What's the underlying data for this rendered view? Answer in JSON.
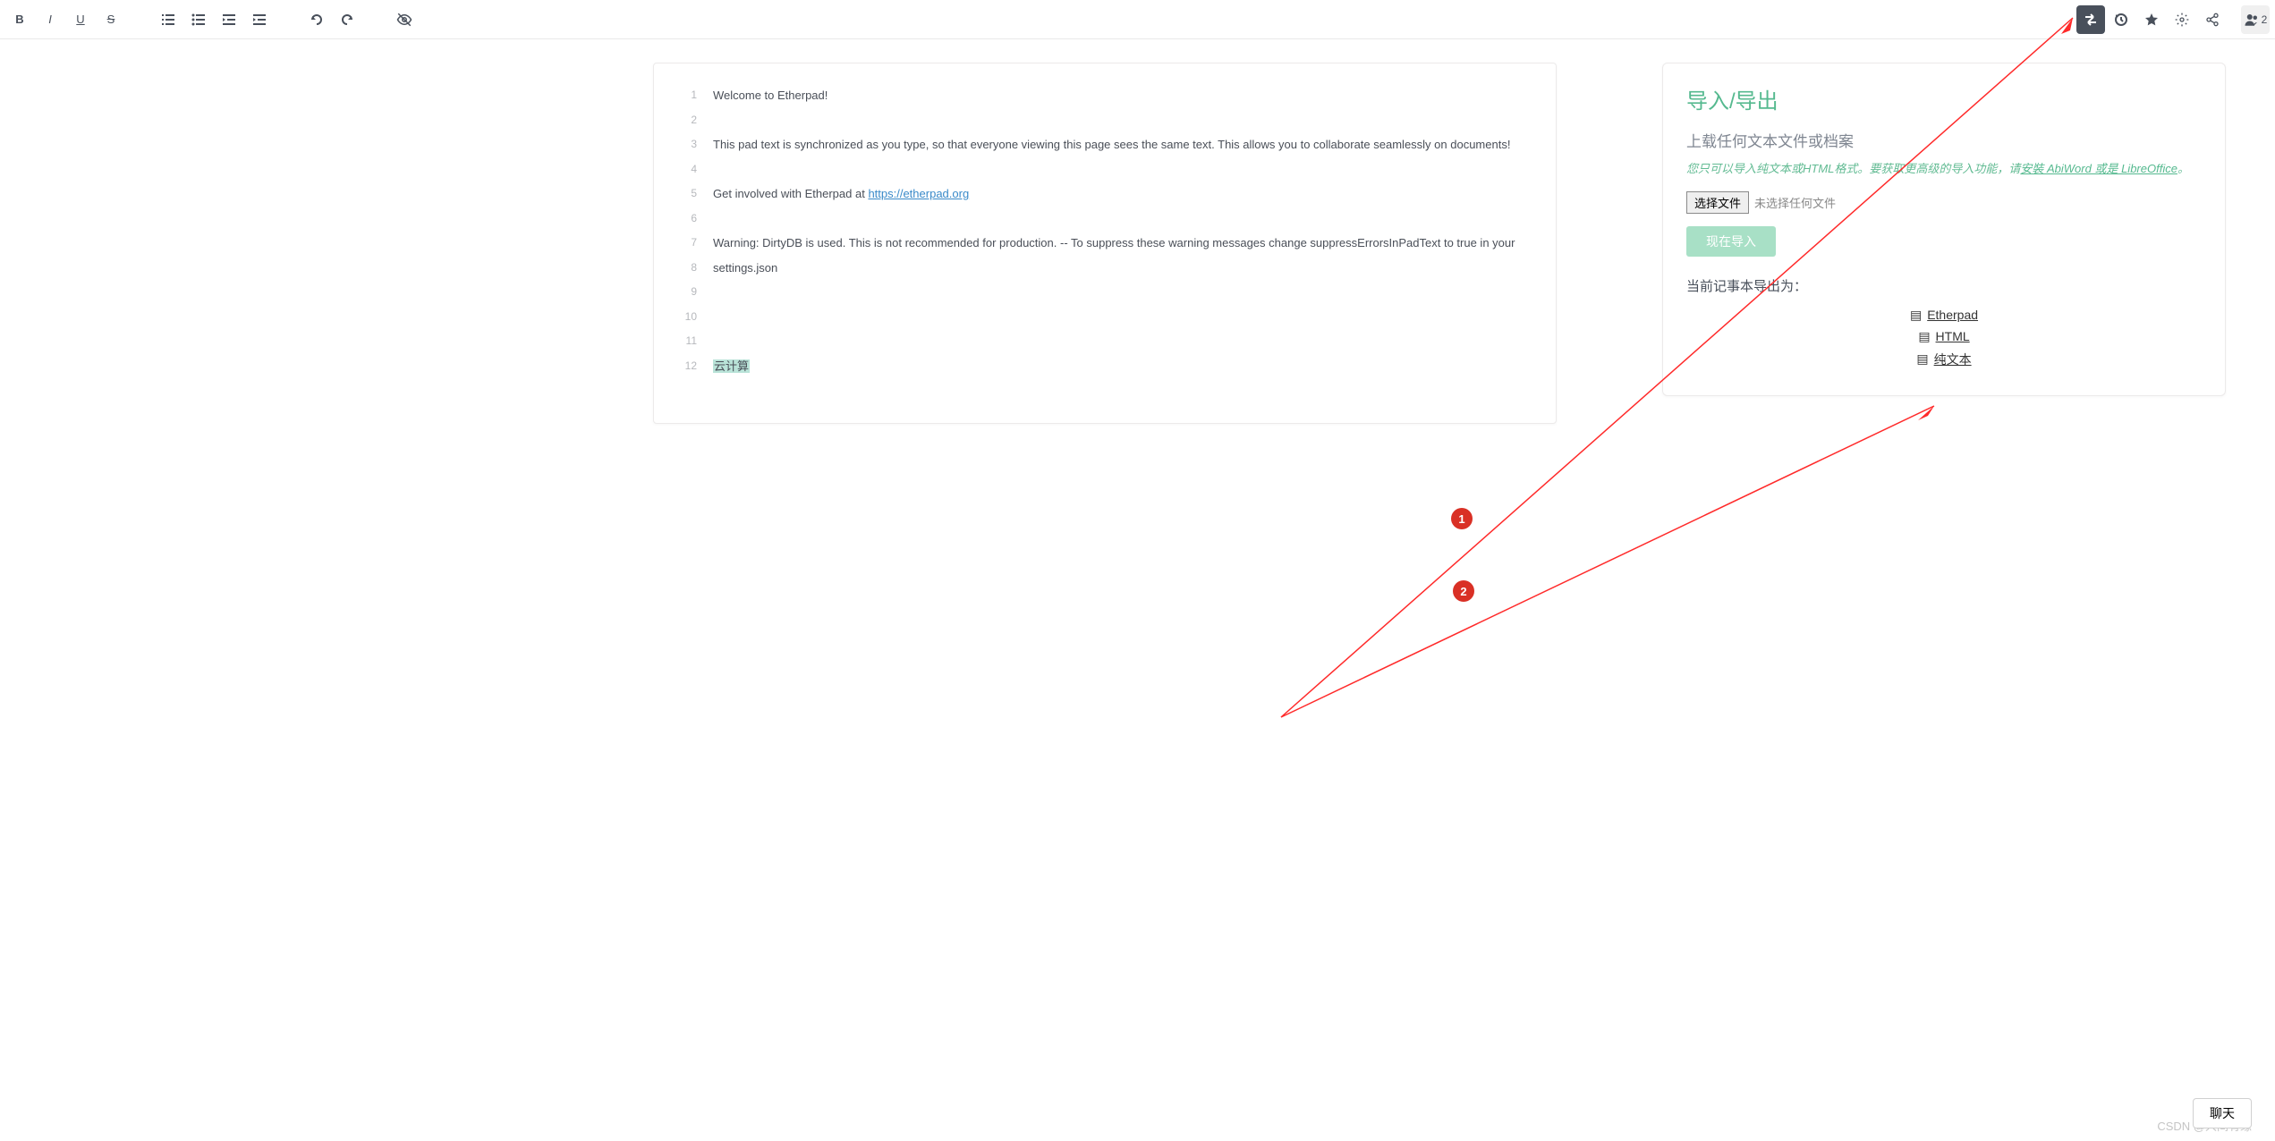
{
  "gutter": {
    "lines": [
      "1",
      "2",
      "3",
      "4",
      "5",
      "6",
      "7",
      "8",
      "9",
      "10",
      "11",
      "12"
    ]
  },
  "content": {
    "l1": "Welcome to Etherpad!",
    "l3a": "This pad text is synchronized as you type, so that everyone viewing this page sees the same text. This allows you to collaborate seamlessly on documents!",
    "l5a": "Get involved with Etherpad at ",
    "l5link": "https://etherpad.org",
    "l7": "Warning: DirtyDB is used. This is not recommended for production. -- To suppress these warning messages change suppressErrorsInPadText to true in your settings.json",
    "l11": "云计算"
  },
  "panel": {
    "title": "导入/导出",
    "uploadTitle": "上载任何文本文件或档案",
    "noteA": "您只可以导入纯文本或HTML格式。要获取更高级的导入功能，请",
    "noteLink": "安裝 AbiWord 或是 LibreOffice",
    "noteB": "。",
    "chooseFile": "选择文件",
    "noFile": "未选择任何文件",
    "importNow": "现在导入",
    "exportTitle": "当前记事本导出为：",
    "exports": {
      "etherpad": "Etherpad",
      "html": "HTML",
      "plain": "纯文本"
    }
  },
  "badges": {
    "b1": "1",
    "b2": "2"
  },
  "chat": "聊天",
  "watermark": "CSDN @人间有缘",
  "usersCount": "2"
}
